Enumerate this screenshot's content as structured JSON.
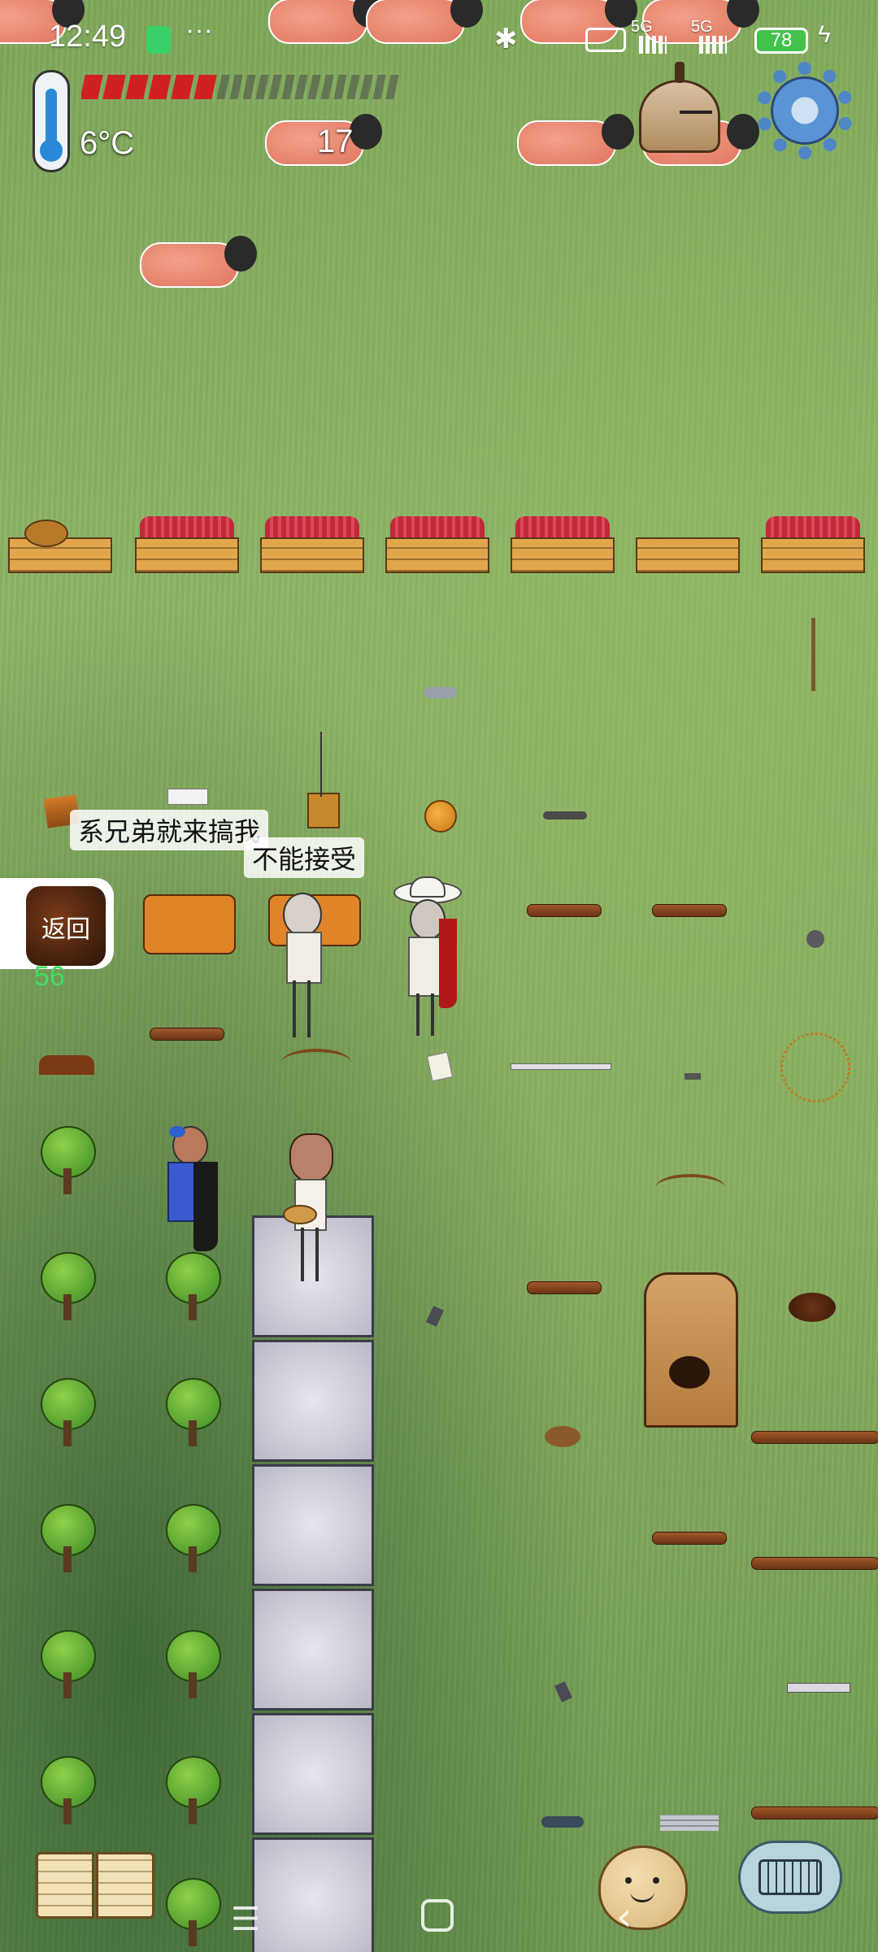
{
  "status_bar": {
    "time": "12:49",
    "more": "···",
    "network_1": "5G",
    "network_2": "5G",
    "battery": "78"
  },
  "hud": {
    "temperature": "6°C",
    "food_level": 6,
    "food_max": 20,
    "age": "17"
  },
  "chat": {
    "line_1": "系兄弟就来搞我",
    "line_2": "不能接受"
  },
  "back_button": {
    "label": "返回",
    "counter": "56"
  },
  "icons": {
    "thermometer": "thermometer-icon",
    "clock": "bell-clock-icon",
    "settings": "gear-icon",
    "book": "recipe-book-icon",
    "emote": "emote-face-icon",
    "keyboard": "keyboard-icon"
  },
  "colors": {
    "food_filled": "#d12020",
    "food_empty": "#4a4a4a",
    "grass": "#88ad60"
  }
}
